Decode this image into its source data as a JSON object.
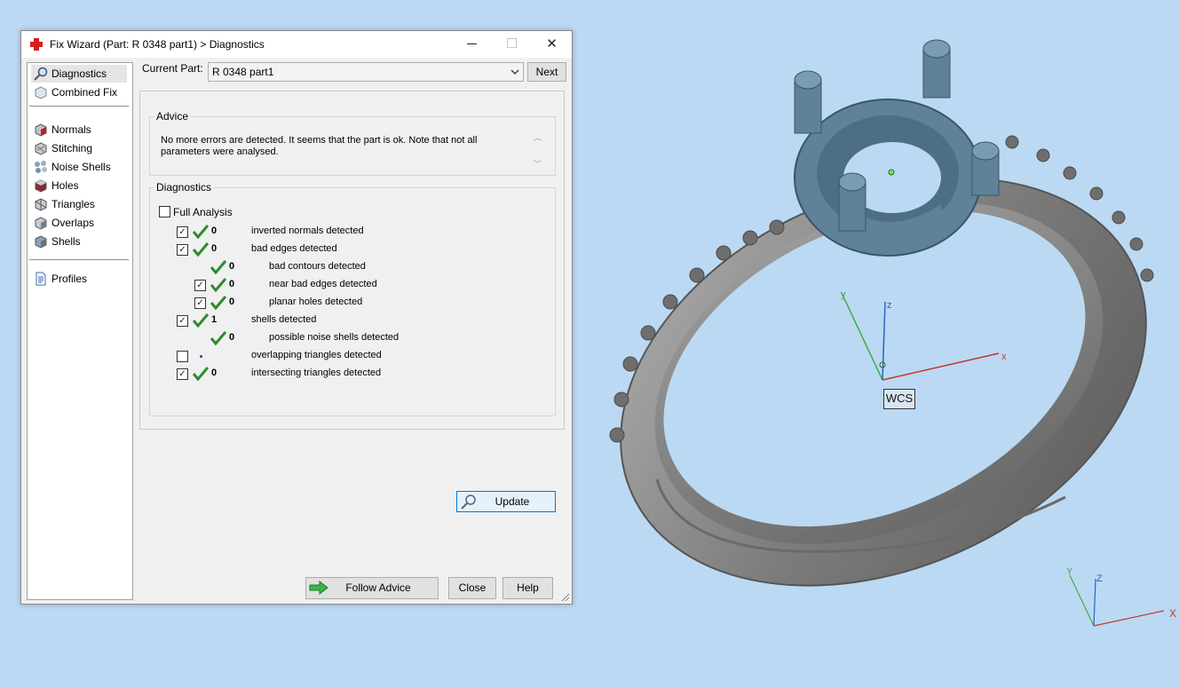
{
  "window": {
    "title": "Fix Wizard (Part: R 0348 part1) > Diagnostics",
    "minimize": "─",
    "maximize": "☐",
    "close": "✕"
  },
  "nav": {
    "items": [
      {
        "label": "Diagnostics",
        "icon": "magnifier-icon",
        "selected": true
      },
      {
        "label": "Combined Fix",
        "icon": "cube-icon"
      },
      {
        "label": "Normals",
        "icon": "normals-cube-icon"
      },
      {
        "label": "Stitching",
        "icon": "stitching-cube-icon"
      },
      {
        "label": "Noise Shells",
        "icon": "noise-shells-icon"
      },
      {
        "label": "Holes",
        "icon": "holes-cube-icon"
      },
      {
        "label": "Triangles",
        "icon": "triangles-cube-icon"
      },
      {
        "label": "Overlaps",
        "icon": "overlaps-cube-icon"
      },
      {
        "label": "Shells",
        "icon": "shells-cube-icon"
      },
      {
        "label": "Profiles",
        "icon": "document-icon"
      }
    ]
  },
  "current_part": {
    "label": "Current Part:",
    "value": "R 0348 part1",
    "next": "Next"
  },
  "advice": {
    "legend": "Advice",
    "text": "No more errors are detected. It seems that the part is ok. Note that not all parameters were analysed."
  },
  "diagnostics": {
    "legend": "Diagnostics",
    "full_analysis": "Full Analysis",
    "full_analysis_checked": false,
    "rows": [
      {
        "checkbox": true,
        "checked": true,
        "status": "ok",
        "count": "0",
        "label": "inverted normals detected",
        "indent": 0
      },
      {
        "checkbox": true,
        "checked": true,
        "status": "ok",
        "count": "0",
        "label": "bad edges detected",
        "indent": 0
      },
      {
        "checkbox": false,
        "checked": false,
        "status": "ok",
        "count": "0",
        "label": "bad contours detected",
        "indent": 1
      },
      {
        "checkbox": true,
        "checked": true,
        "status": "ok",
        "count": "0",
        "label": "near bad edges detected",
        "indent": 1
      },
      {
        "checkbox": true,
        "checked": true,
        "status": "ok",
        "count": "0",
        "label": "planar holes detected",
        "indent": 1
      },
      {
        "checkbox": true,
        "checked": true,
        "status": "ok",
        "count": "1",
        "label": "shells detected",
        "indent": 0
      },
      {
        "checkbox": false,
        "checked": false,
        "status": "ok",
        "count": "0",
        "label": "possible noise shells detected",
        "indent": 1
      },
      {
        "checkbox": true,
        "checked": false,
        "status": "none",
        "count": "",
        "label": "overlapping triangles detected",
        "indent": 0
      },
      {
        "checkbox": true,
        "checked": true,
        "status": "ok",
        "count": "0",
        "label": "intersecting triangles detected",
        "indent": 0
      }
    ],
    "update": "Update"
  },
  "footer": {
    "follow_advice": "Follow Advice",
    "close": "Close",
    "help": "Help"
  },
  "viewport": {
    "wcs_label": "WCS",
    "axes_main": {
      "x": "x",
      "y": "y",
      "z": "z"
    },
    "axes_corner": {
      "x": "X",
      "y": "Y",
      "z": "Z"
    },
    "colors": {
      "background": "#bcd9f3",
      "ring": "#8a8a8a",
      "setting": "#5f8299",
      "x_axis": "#c0392b",
      "y_axis": "#3cb043",
      "z_axis": "#2a63c6"
    }
  }
}
